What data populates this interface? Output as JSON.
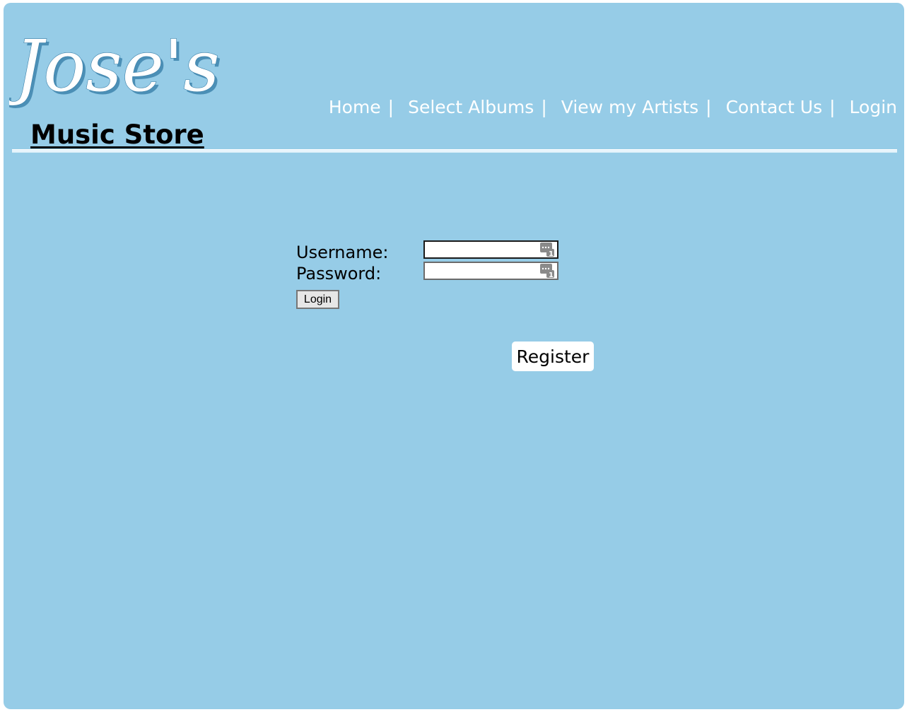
{
  "header": {
    "logo_text": "Jose's",
    "store_name": "Music Store"
  },
  "nav": {
    "items": [
      {
        "label": "Home",
        "sep": "|"
      },
      {
        "label": "Select Albums",
        "sep": "|"
      },
      {
        "label": "View my Artists",
        "sep": "|"
      },
      {
        "label": "Contact Us",
        "sep": "|"
      },
      {
        "label": "Login"
      }
    ]
  },
  "login_form": {
    "username_label": "Username:",
    "username_value": "",
    "password_label": "Password:",
    "password_value": "",
    "submit_label": "Login"
  },
  "register": {
    "label": "Register"
  },
  "colors": {
    "page_background": "#96cce7",
    "nav_text": "#ffffff",
    "register_background": "#ffffff"
  },
  "icons": {
    "field_autofill_icon": "password-manager-key-icon"
  }
}
